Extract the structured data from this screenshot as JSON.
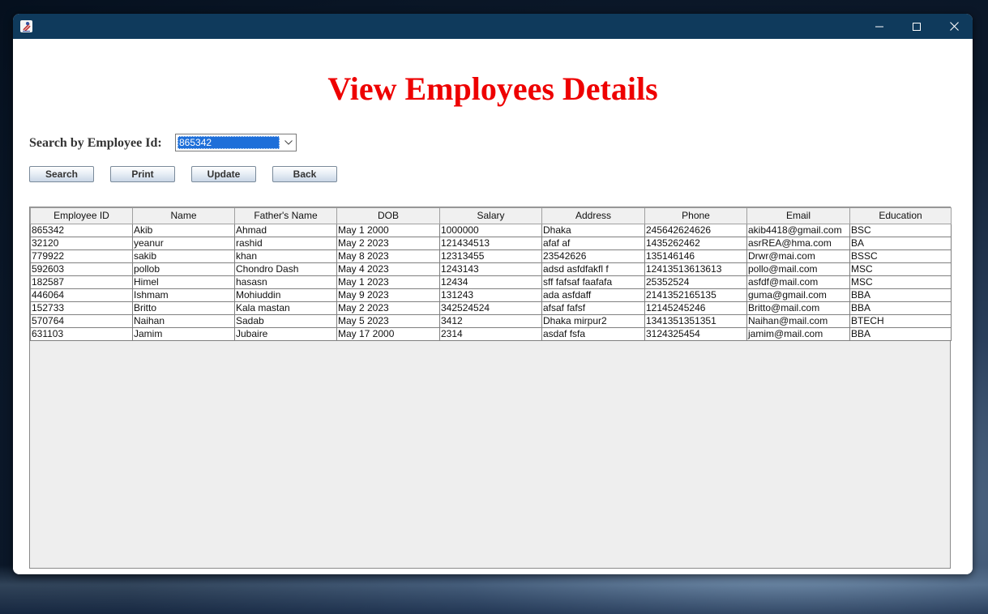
{
  "window": {
    "title": ""
  },
  "page": {
    "title": "View Employees Details",
    "search_label": "Search by Employee Id:",
    "selected_id": "865342"
  },
  "buttons": {
    "search": "Search",
    "print": "Print",
    "update": "Update",
    "back": "Back"
  },
  "table": {
    "columns": [
      "Employee ID",
      "Name",
      "Father's Name",
      "DOB",
      "Salary",
      "Address",
      "Phone",
      "Email",
      "Education"
    ],
    "rows": [
      [
        "865342",
        "Akib",
        "Ahmad",
        "May 1 2000",
        "1000000",
        "Dhaka",
        "245642624626",
        "akib4418@gmail.com",
        "BSC"
      ],
      [
        "32120",
        "yeanur",
        "rashid",
        "May 2 2023",
        "121434513",
        "afaf af",
        "1435262462",
        "asrREA@hma.com",
        "BA"
      ],
      [
        "779922",
        "sakib",
        "khan",
        "May 8 2023",
        "12313455",
        "23542626",
        "135146146",
        "Drwr@mai.com",
        "BSSC"
      ],
      [
        "592603",
        "pollob",
        "Chondro Dash",
        "May 4 2023",
        "1243143",
        "adsd asfdfakfl f",
        "12413513613613",
        "pollo@mail.com",
        "MSC"
      ],
      [
        "182587",
        "Himel",
        "hasasn",
        "May 1 2023",
        "12434",
        "sff fafsaf faafafa",
        "25352524",
        "asfdf@mail.com",
        "MSC"
      ],
      [
        "446064",
        "Ishmam",
        "Mohiuddin",
        "May 9 2023",
        "131243",
        "ada asfdaff",
        "2141352165135",
        "guma@gmail.com",
        "BBA"
      ],
      [
        "152733",
        "Britto",
        "Kala mastan",
        "May 2 2023",
        "342524524",
        "afsaf fafsf",
        "12145245246",
        "Britto@mail.com",
        "BBA"
      ],
      [
        "570764",
        "Naihan",
        "Sadab",
        "May 5 2023",
        "3412",
        "Dhaka mirpur2",
        "1341351351351",
        "Naihan@mail.com",
        "BTECH"
      ],
      [
        "631103",
        "Jamim",
        "Jubaire",
        "May 17 2000",
        "2314",
        "asdaf fsfa",
        "3124325454",
        "jamim@mail.com",
        "BBA"
      ]
    ]
  },
  "icons": {
    "app": "java-app-icon",
    "minimize": "minimize-icon",
    "maximize": "maximize-icon",
    "close": "close-icon",
    "dropdown": "chevron-down-icon"
  },
  "colors": {
    "titlebar": "#0f3a5c",
    "title_text": "#ee0000",
    "selection": "#1e6fd9"
  }
}
